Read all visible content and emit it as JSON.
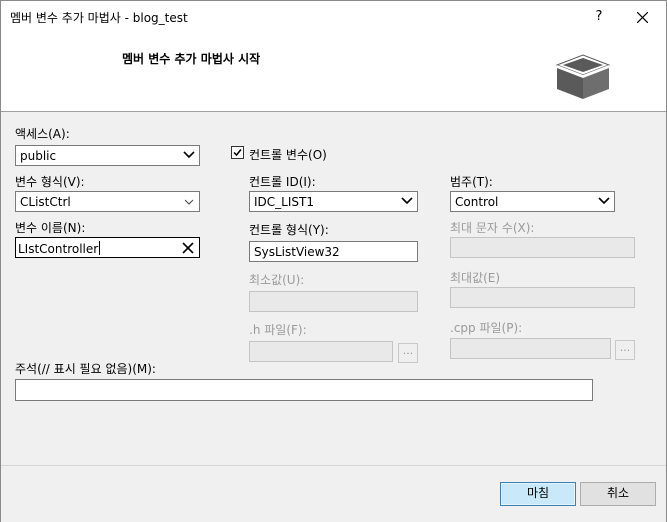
{
  "window": {
    "title": "멤버 변수 추가 마법사 - blog_test",
    "help_label": "?"
  },
  "banner": {
    "heading": "멤버 변수 추가 마법사 시작",
    "icon": "box-icon"
  },
  "form": {
    "access": {
      "label": "액세스(A):",
      "value": "public"
    },
    "control_variable": {
      "label": "컨트롤 변수(O)",
      "checked": true
    },
    "var_type": {
      "label": "변수 형식(V):",
      "value": "CListCtrl"
    },
    "var_name": {
      "label": "변수 이름(N):",
      "value": "LIstController"
    },
    "control_id": {
      "label": "컨트롤 ID(I):",
      "value": "IDC_LIST1"
    },
    "control_type": {
      "label": "컨트롤 형식(Y):",
      "value": "SysListView32"
    },
    "min_value": {
      "label": "최소값(U):",
      "value": ""
    },
    "h_file": {
      "label": ".h 파일(F):",
      "value": "",
      "browse": "..."
    },
    "category": {
      "label": "범주(T):",
      "value": "Control"
    },
    "max_chars": {
      "label": "최대 문자 수(X):",
      "value": ""
    },
    "max_value": {
      "label": "최대값(E)",
      "value": ""
    },
    "cpp_file": {
      "label": ".cpp 파일(P):",
      "value": "",
      "browse": "..."
    },
    "comment": {
      "label": "주석(// 표시 필요 없음)(M):",
      "value": ""
    }
  },
  "footer": {
    "finish_label": "마침",
    "cancel_label": "취소"
  }
}
